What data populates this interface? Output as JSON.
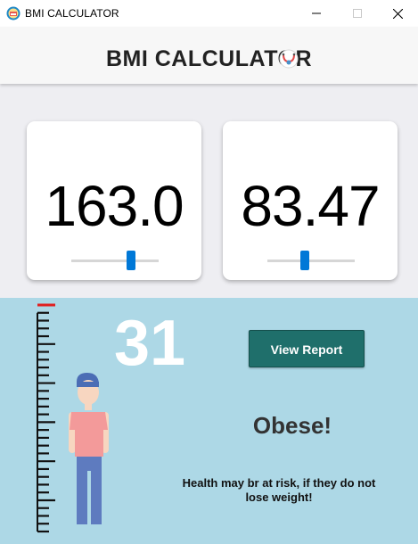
{
  "window": {
    "title": "BMI CALCULATOR",
    "controls": [
      "minimize",
      "maximize",
      "close"
    ]
  },
  "header": {
    "title": "BMI CALCULATOR",
    "logo_icon": "stethoscope-icon"
  },
  "height_card": {
    "value": "163.0",
    "slider_fraction": 0.7
  },
  "weight_card": {
    "value": "83.47",
    "slider_fraction": 0.42
  },
  "result": {
    "bmi": "31",
    "view_report_label": "View Report",
    "status": "Obese!",
    "message": "Health may br at risk, if they do not lose weight!"
  },
  "colors": {
    "accent_blue": "#0078d7",
    "result_bg": "#add8e6",
    "button_bg": "#1f6f6b",
    "ruler_marker": "#e02020"
  }
}
